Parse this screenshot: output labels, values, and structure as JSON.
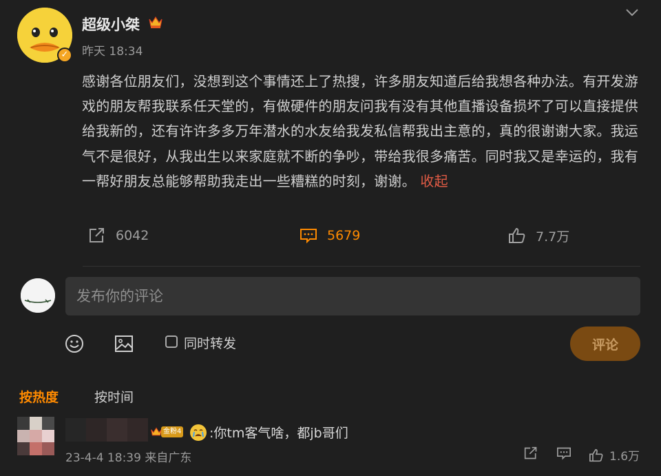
{
  "post": {
    "username": "超级小桀",
    "timestamp": "昨天 18:34",
    "text": "感谢各位朋友们，没想到这个事情还上了热搜，许多朋友知道后给我想各种办法。有开发游戏的朋友帮我联系任天堂的，有做硬件的朋友问我有没有其他直播设备损坏了可以直接提供给我新的，还有许许多多万年潜水的水友给我发私信帮我出主意的，真的很谢谢大家。我运气不是很好，从我出生以来家庭就不断的争吵，带给我很多痛苦。同时我又是幸运的，我有一帮好朋友总能够帮助我走出一些糟糕的时刻，谢谢。",
    "collapse_label": "收起",
    "stats": {
      "reposts": "6042",
      "comments": "5679",
      "likes": "7.7万"
    }
  },
  "composer": {
    "placeholder": "发布你的评论",
    "repost_label": "同时转发",
    "submit_label": "评论"
  },
  "sort_tabs": {
    "hot": "按热度",
    "time": "按时间"
  },
  "comments": [
    {
      "badge_level": "金粉4",
      "text": ":你tm客气啥，都jb哥们",
      "meta": "23-4-4 18:39 来自广东",
      "likes": "1.6万"
    }
  ],
  "colors": {
    "accent": "#ff8a00",
    "collapse": "#e05b45",
    "background": "#1f1f1f"
  },
  "icons": [
    "crown-icon",
    "verified-icon",
    "chevron-down-icon",
    "repost-icon",
    "comment-icon",
    "like-icon",
    "emoji-icon",
    "image-icon",
    "crying-emoji-icon"
  ]
}
